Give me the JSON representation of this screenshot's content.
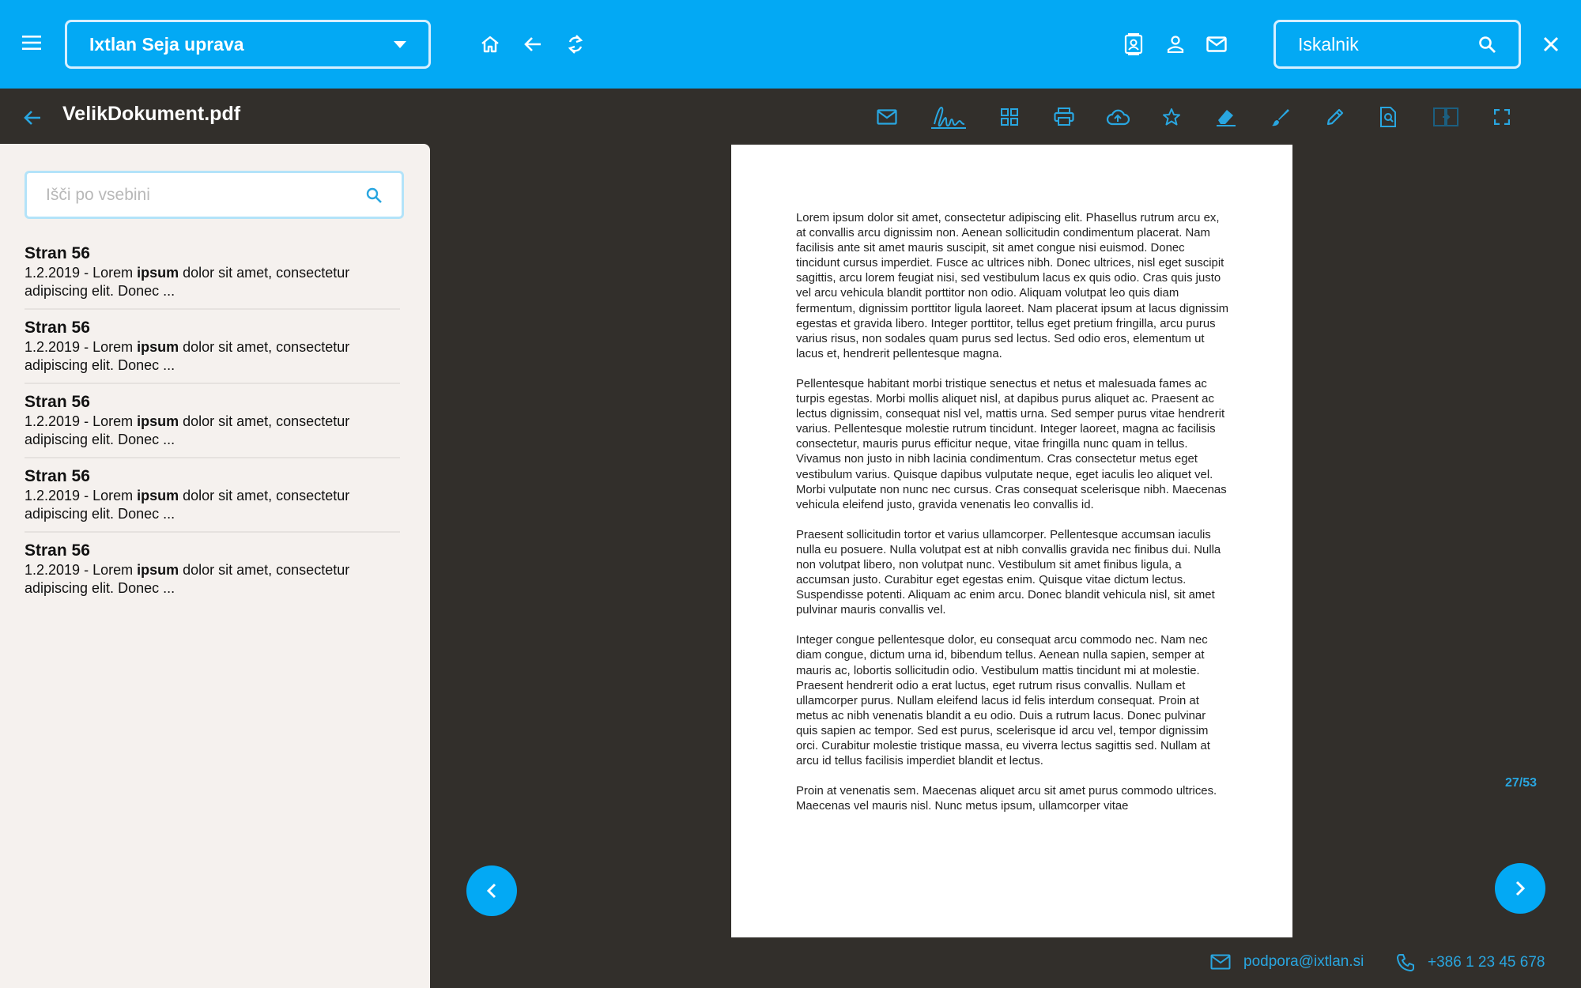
{
  "topbar": {
    "organization": "Ixtlan Seja uprava",
    "search_label": "Iskalnik",
    "icons": [
      "menu-icon",
      "home-icon",
      "arrow-back-icon",
      "refresh-icon",
      "contact-card-icon",
      "person-icon",
      "mail-icon",
      "search-icon",
      "close-icon"
    ]
  },
  "document": {
    "title": "VelikDokument.pdf",
    "toolbar_icons": [
      "mail-icon",
      "signature-icon",
      "grid-icon",
      "print-icon",
      "cloud-upload-icon",
      "star-icon",
      "eraser-icon",
      "brush-icon",
      "pencil-icon",
      "find-in-page-icon",
      "compare-icon",
      "fullscreen-icon"
    ]
  },
  "sidebar": {
    "search_placeholder": "Išči po vsebini",
    "results": [
      {
        "title": "Stran 56",
        "prefix": "1.2.2019 - Lorem ",
        "highlight": "ipsum",
        "suffix": " dolor sit amet, consectetur adipiscing elit. Donec ..."
      },
      {
        "title": "Stran 56",
        "prefix": "1.2.2019 - Lorem ",
        "highlight": "ipsum",
        "suffix": " dolor sit amet, consectetur adipiscing elit. Donec ..."
      },
      {
        "title": "Stran 56",
        "prefix": "1.2.2019 - Lorem ",
        "highlight": "ipsum",
        "suffix": " dolor sit amet, consectetur adipiscing elit. Donec ..."
      },
      {
        "title": "Stran 56",
        "prefix": "1.2.2019 - Lorem ",
        "highlight": "ipsum",
        "suffix": " dolor sit amet, consectetur adipiscing elit. Donec ..."
      },
      {
        "title": "Stran 56",
        "prefix": "1.2.2019 - Lorem ",
        "highlight": "ipsum",
        "suffix": " dolor sit amet, consectetur adipiscing elit. Donec ..."
      }
    ]
  },
  "viewer": {
    "page_indicator": "27/53",
    "paragraphs": [
      "Lorem ipsum dolor sit amet, consectetur adipiscing elit. Phasellus rutrum arcu ex, at convallis arcu dignissim non. Aenean sollicitudin condimentum placerat. Nam facilisis ante sit amet mauris suscipit, sit amet congue nisi euismod. Donec tincidunt cursus imperdiet. Fusce ac ultrices nibh. Donec ultrices, nisl eget suscipit sagittis, arcu lorem feugiat nisi, sed vestibulum lacus ex quis odio. Cras quis justo vel arcu vehicula blandit porttitor non odio. Aliquam volutpat leo quis diam fermentum, dignissim porttitor ligula laoreet. Nam placerat ipsum at lacus dignissim egestas et gravida libero. Integer porttitor, tellus eget pretium fringilla, arcu purus varius risus, non sodales quam purus sed lectus. Sed odio eros, elementum ut lacus et, hendrerit pellentesque magna.",
      "Pellentesque habitant morbi tristique senectus et netus et malesuada fames ac turpis egestas. Morbi mollis aliquet nisl, at dapibus purus aliquet ac. Praesent ac lectus dignissim, consequat nisl vel, mattis urna. Sed semper purus vitae hendrerit varius. Pellentesque molestie rutrum tincidunt. Integer laoreet, magna ac facilisis consectetur, mauris purus efficitur neque, vitae fringilla nunc quam in tellus. Vivamus non justo in nibh lacinia condimentum. Cras consectetur metus eget vestibulum varius. Quisque dapibus vulputate neque, eget iaculis leo aliquet vel. Morbi vulputate non nunc nec cursus. Cras consequat scelerisque nibh. Maecenas vehicula eleifend justo, gravida venenatis leo convallis id.",
      "Praesent sollicitudin tortor et varius ullamcorper. Pellentesque accumsan iaculis nulla eu posuere. Nulla volutpat est at nibh convallis gravida nec finibus dui. Nulla non volutpat libero, non volutpat nunc. Vestibulum sit amet finibus ligula, a accumsan justo. Curabitur eget egestas enim. Quisque vitae dictum lectus. Suspendisse potenti. Aliquam ac enim arcu. Donec blandit vehicula nisl, sit amet pulvinar mauris convallis vel.",
      "Integer congue pellentesque dolor, eu consequat arcu commodo nec. Nam nec diam congue, dictum urna id, bibendum tellus. Aenean nulla sapien, semper at mauris ac, lobortis sollicitudin odio. Vestibulum mattis tincidunt mi at molestie. Praesent hendrerit odio a erat luctus, eget rutrum risus convallis. Nullam et ullamcorper purus. Nullam eleifend lacus id felis interdum consequat. Proin at metus ac nibh venenatis blandit a eu odio. Duis a rutrum lacus. Donec pulvinar quis sapien ac tempor. Sed est purus, scelerisque id arcu vel, tempor dignissim orci. Curabitur molestie tristique massa, eu viverra lectus sagittis sed. Nullam at arcu id tellus facilisis imperdiet blandit et lectus.",
      "Proin at venenatis sem. Maecenas aliquet arcu sit amet purus commodo ultrices. Maecenas vel mauris nisl. Nunc metus ipsum, ullamcorper vitae"
    ]
  },
  "footer": {
    "email": "podpora@ixtlan.si",
    "phone": "+386 1 23 45 678"
  },
  "colors": {
    "primary": "#03a9f4",
    "dark_bg": "#322f2b",
    "sidebar_bg": "#f5f1ee"
  }
}
